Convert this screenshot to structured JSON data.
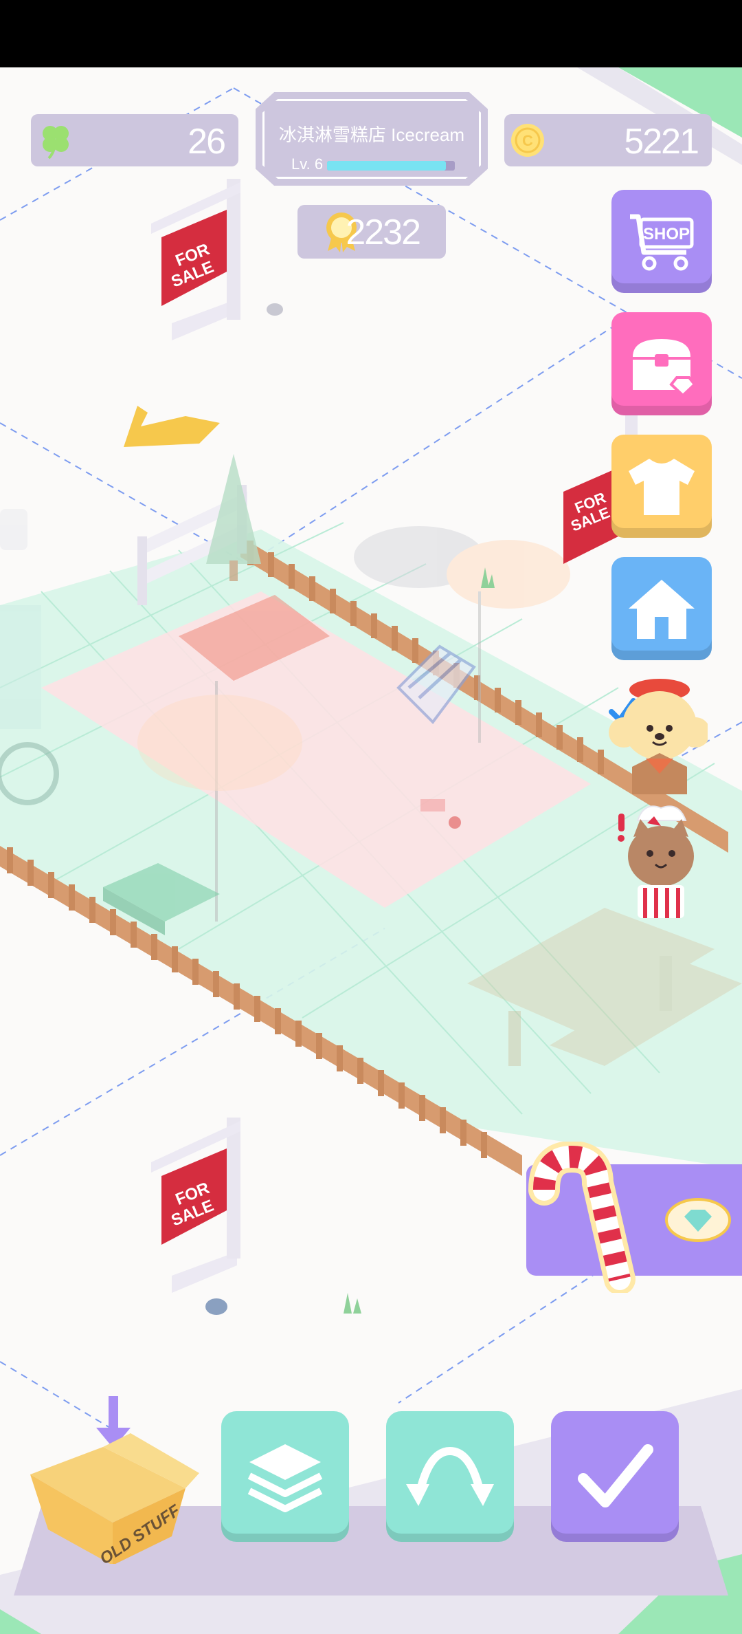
{
  "hud": {
    "clover_count": "26",
    "shop_name": "冰淇淋雪糕店 Icecream",
    "level_label": "Lv. 6",
    "level_progress": 0.93,
    "coin_count": "5221",
    "award_points": "2232"
  },
  "side_buttons": {
    "shop_label": "SHOP"
  },
  "signs": {
    "for_sale_line1": "FOR",
    "for_sale_line2": "SALE"
  },
  "box": {
    "label": "OLD STUFF"
  },
  "colors": {
    "purple": "#a98ef4",
    "pink": "#ff6dbd",
    "yellow": "#ffce6a",
    "blue": "#6ab4f6",
    "teal": "#8fe5d6",
    "hud_grey": "#cdc6de"
  },
  "icons": [
    "clover-icon",
    "coin-icon",
    "award-icon",
    "shop-icon",
    "chest-icon",
    "shirt-icon",
    "house-icon",
    "layers-icon",
    "rotate-icon",
    "check-icon",
    "candy-cane-icon",
    "gem-icon"
  ]
}
